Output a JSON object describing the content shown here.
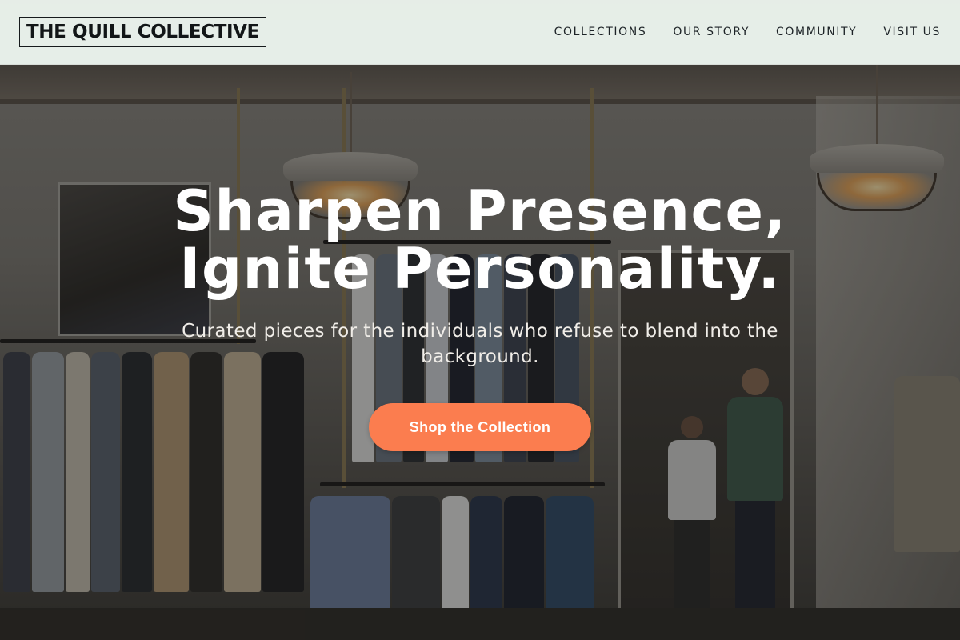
{
  "brand": {
    "name": "THE QUILL COLLECTIVE"
  },
  "nav": {
    "items": [
      {
        "label": "COLLECTIONS"
      },
      {
        "label": "OUR STORY"
      },
      {
        "label": "COMMUNITY"
      },
      {
        "label": "VISIT US"
      }
    ]
  },
  "hero": {
    "headline_line1": "Sharpen Presence,",
    "headline_line2": "Ignite Personality.",
    "subtitle": "Curated pieces for the individuals who refuse to blend into the background.",
    "cta_label": "Shop the Collection",
    "background_image": "clothing-store-interior"
  },
  "colors": {
    "nav_background": "#ecf5ee",
    "cta_background": "#fb7d4f",
    "headline_text": "#ffffff",
    "logo_text": "#121617"
  }
}
